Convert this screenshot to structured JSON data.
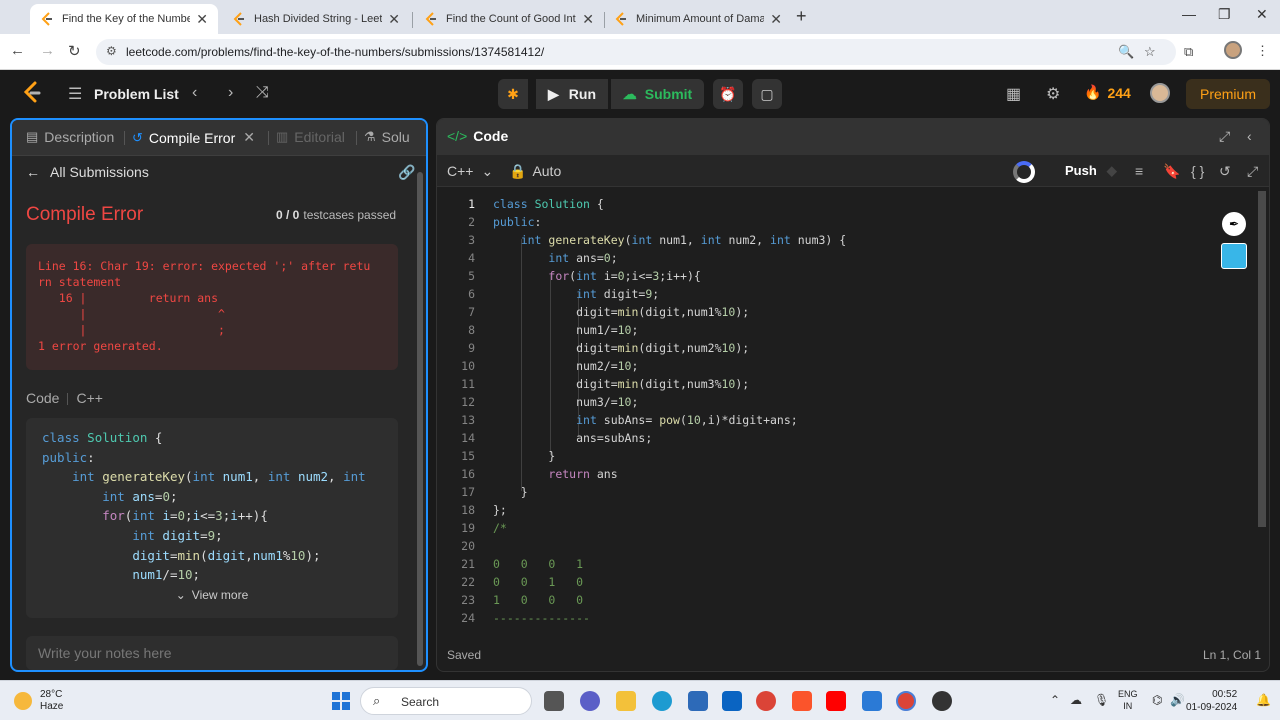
{
  "browser": {
    "tabs": [
      {
        "title": "Find the Key of the Numbers - L",
        "active": true
      },
      {
        "title": "Hash Divided String - LeetCode",
        "active": false
      },
      {
        "title": "Find the Count of Good Integer",
        "active": false
      },
      {
        "title": "Minimum Amount of Damage D",
        "active": false
      }
    ],
    "url": "leetcode.com/problems/find-the-key-of-the-numbers/submissions/1374581412/"
  },
  "header": {
    "problem_list": "Problem List",
    "run": "Run",
    "submit": "Submit",
    "streak": "244",
    "premium": "Premium"
  },
  "left": {
    "tabs": [
      "Description",
      "Compile Error",
      "Editorial",
      "Solu"
    ],
    "all_submissions": "All Submissions",
    "error_title": "Compile Error",
    "testcases_count": "0 / 0",
    "testcases_label": "testcases passed",
    "error_text": "Line 16: Char 19: error: expected ';' after retu\nrn statement\n   16 |         return ans\n      |                   ^\n      |                   ;\n1 error generated.",
    "code_label": "Code",
    "code_lang": "C++",
    "view_more": "View more",
    "notes_placeholder": "Write your notes here"
  },
  "editor": {
    "title": "Code",
    "language": "C++",
    "mode": "Auto",
    "push": "Push",
    "status": "Saved",
    "position": "Ln 1, Col 1"
  },
  "taskbar": {
    "temp": "28°C",
    "weather": "Haze",
    "search": "Search",
    "lang1": "ENG",
    "lang2": "IN",
    "time": "00:52",
    "date": "01-09-2024"
  },
  "colors": {
    "accent_blue": "#1e90ff",
    "error_red": "#ef4743",
    "success_green": "#2cbb5d",
    "streak_orange": "#ffa116"
  }
}
